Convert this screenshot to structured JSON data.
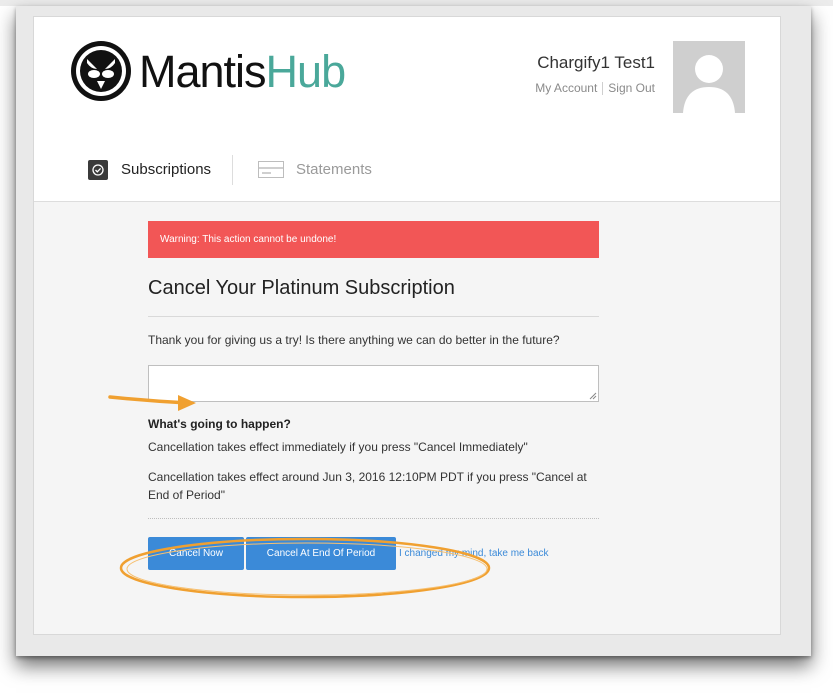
{
  "app": {
    "logo": {
      "part1": "Mantis",
      "part2": "Hub"
    }
  },
  "user": {
    "name": "Chargify1 Test1",
    "my_account": "My Account",
    "sign_out": "Sign Out"
  },
  "nav": {
    "subscriptions": "Subscriptions",
    "statements": "Statements"
  },
  "page": {
    "warning": "Warning: This action cannot be undone!",
    "title": "Cancel Your Platinum Subscription",
    "question": "Thank you for giving us a try! Is there anything we can do better in the future?",
    "feedback_value": "",
    "what_heading": "What's going to happen?",
    "immediate_text": "Cancellation takes effect immediately if you press \"Cancel Immediately\"",
    "period_text": "Cancellation takes effect around Jun 3, 2016 12:10PM PDT if you press \"Cancel at End of Period\""
  },
  "actions": {
    "cancel_now": "Cancel Now",
    "cancel_end": "Cancel At End Of Period",
    "back": "I changed my mind, take me back"
  },
  "colors": {
    "accent": "#3b8ad8",
    "warning": "#f25656",
    "brand": "#4aa89a",
    "annotation": "#f0a030"
  }
}
